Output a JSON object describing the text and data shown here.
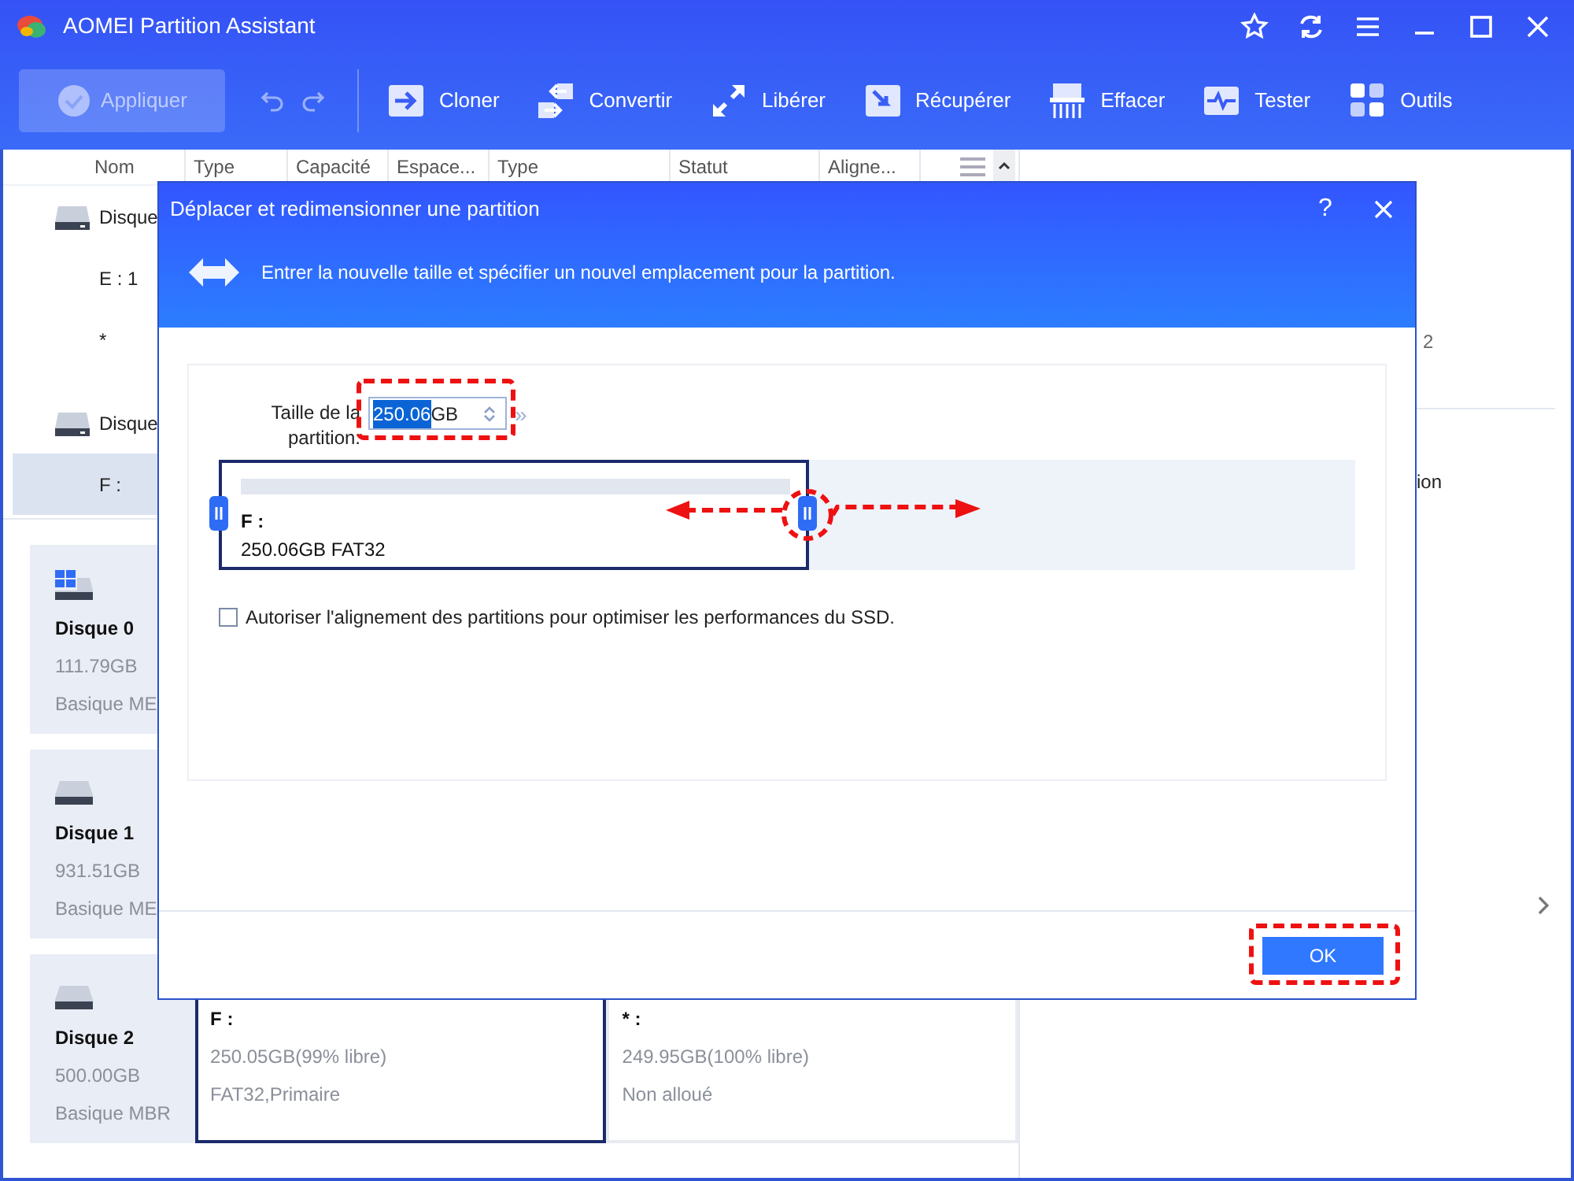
{
  "window": {
    "title": "AOMEI Partition Assistant"
  },
  "toolbar": {
    "apply": {
      "label": "Appliquer",
      "disabled": true
    },
    "tools": [
      {
        "kind": "clone",
        "label": "Cloner"
      },
      {
        "kind": "convert",
        "label": "Convertir"
      },
      {
        "kind": "free",
        "label": "Libérer"
      },
      {
        "kind": "recover",
        "label": "Récupérer"
      },
      {
        "kind": "wipe",
        "label": "Effacer"
      },
      {
        "kind": "test",
        "label": "Tester"
      },
      {
        "kind": "tools",
        "label": "Outils"
      }
    ]
  },
  "columns": [
    "Nom",
    "Type",
    "Capacité",
    "Espace...",
    "Type",
    "Statut",
    "Aligne..."
  ],
  "list_rows": [
    {
      "kind": "disk",
      "label": "Disque",
      "selected": false
    },
    {
      "kind": "partition",
      "label": "E : 1",
      "selected": false
    },
    {
      "kind": "partition",
      "label": "*",
      "selected": false
    },
    {
      "kind": "disk",
      "label": "Disque",
      "selected": false
    },
    {
      "kind": "partition",
      "label": "F :",
      "selected": true
    }
  ],
  "right_panel": {
    "text_1": "2",
    "text_2": "ion"
  },
  "disks": [
    {
      "kind": "system",
      "name": "Disque 0",
      "size": "111.79GB",
      "type": "Basique ME"
    },
    {
      "kind": "data",
      "name": "Disque 1",
      "size": "931.51GB",
      "type": "Basique ME"
    },
    {
      "kind": "data",
      "name": "Disque 2",
      "size": "500.00GB",
      "type": "Basique MBR",
      "partitions": [
        {
          "name": "F :",
          "detail": "250.05GB(99% libre)",
          "info": "FAT32,Primaire",
          "selected": true
        },
        {
          "name": "* :",
          "detail": "249.95GB(100% libre)",
          "info": "Non alloué",
          "selected": false
        }
      ]
    }
  ],
  "dialog": {
    "title": "Déplacer et redimensionner une partition",
    "help": "?",
    "subtitle": "Entrer la nouvelle taille et spécifier un nouvel emplacement pour la partition.",
    "size_label": "Taille de la partition:",
    "size_value": "250.06",
    "size_unit": "GB",
    "more": "»",
    "partition": {
      "name": "F :",
      "detail": "250.06GB FAT32",
      "level": 0.52
    },
    "alignment": {
      "label": "Autoriser l'alignement des partitions pour optimiser les performances du SSD.",
      "checked": false
    },
    "ok": "OK"
  }
}
